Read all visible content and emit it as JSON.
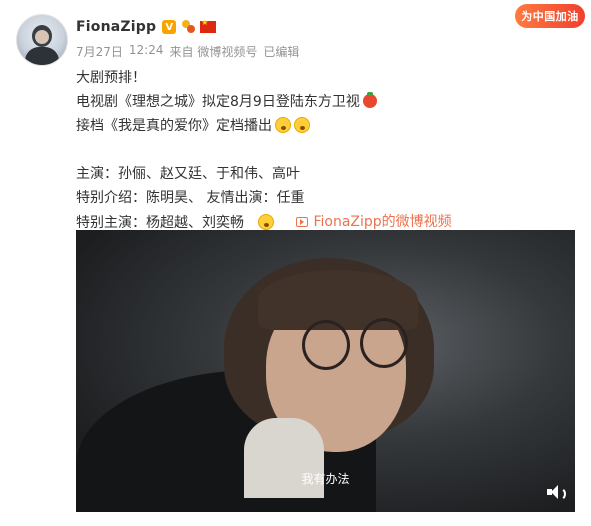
{
  "user": {
    "name": "FionaZipp",
    "verified_badge": "V"
  },
  "meta": {
    "date": "7月27日",
    "time": "12:24",
    "source": "来自 微博视频号",
    "edited": "已编辑"
  },
  "banner": {
    "text": "为中国加油"
  },
  "post": {
    "line1": "大剧预排！",
    "line2": "电视剧《理想之城》拟定8月9日登陆东方卫视",
    "line3": "接档《我是真的爱你》定档播出",
    "line4": "主演：孙俪、赵又廷、于和伟、高叶",
    "line5": "特别介绍：陈明昊、 友情出演：任重",
    "line6": "特别主演：杨超越、刘奕畅",
    "video_link": "FionaZipp的微博视频"
  },
  "video": {
    "subtitle": "我有办法"
  },
  "icons": {
    "volume": "volume-icon",
    "play_link": "video-link-icon"
  },
  "colors": {
    "accent": "#eb7350",
    "badge": "#f7a400",
    "banner": "#f0402e"
  }
}
